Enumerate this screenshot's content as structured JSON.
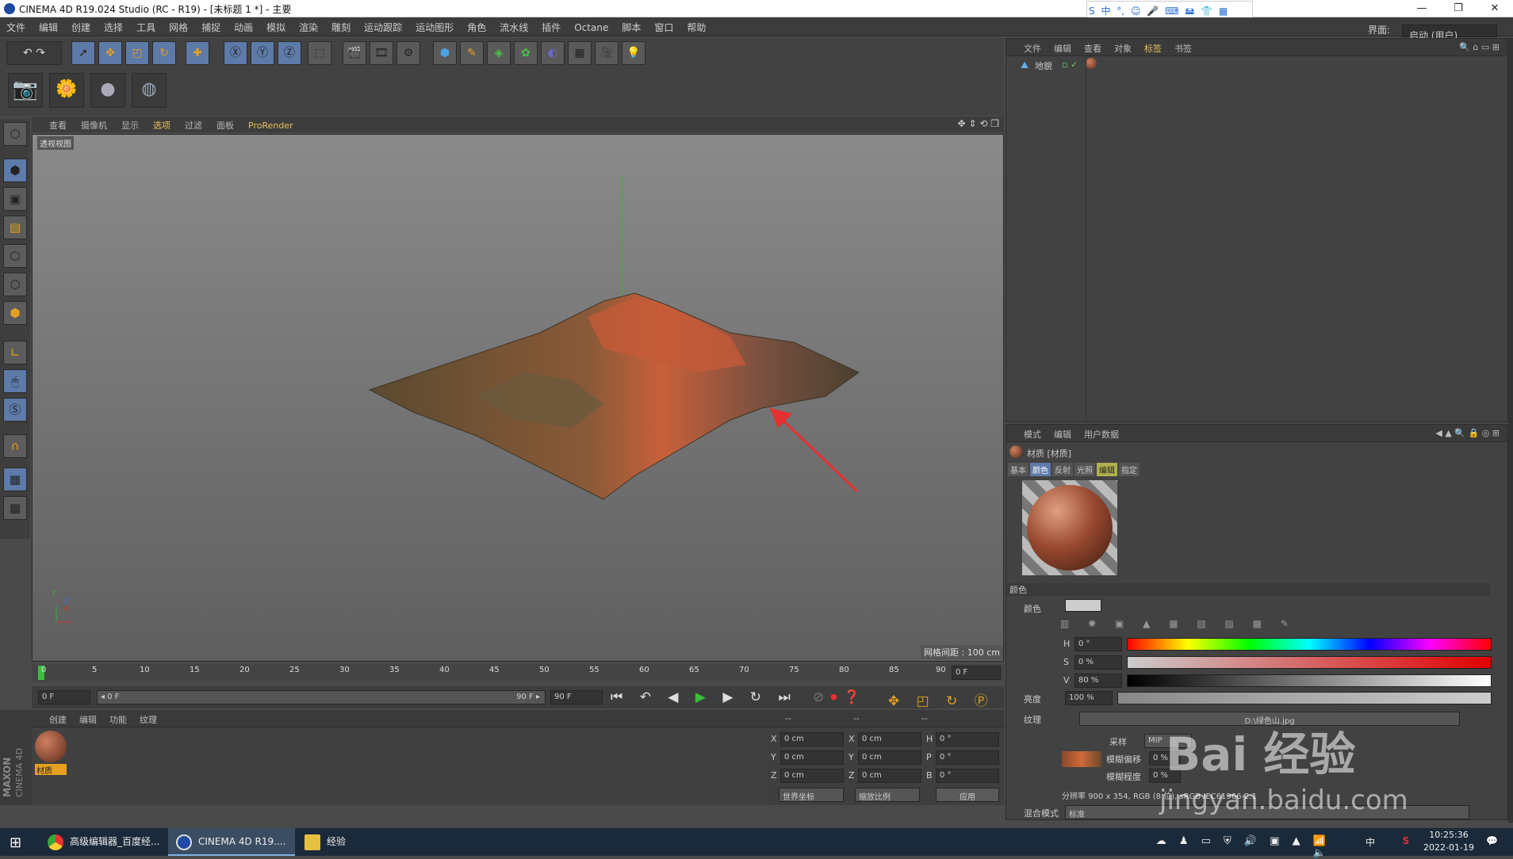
{
  "window": {
    "title": "CINEMA 4D R19.024 Studio (RC - R19) - [未标题 1 *] - 主要",
    "minimize": "—",
    "restore": "❐",
    "close": "✕"
  },
  "ime": {
    "items": [
      "S",
      "中",
      "°,",
      "☺",
      "🎤",
      "⌨",
      "🖴",
      "👕",
      "▦"
    ]
  },
  "menu": [
    "文件",
    "编辑",
    "创建",
    "选择",
    "工具",
    "网格",
    "捕捉",
    "动画",
    "模拟",
    "渲染",
    "雕刻",
    "运动跟踪",
    "运动图形",
    "角色",
    "流水线",
    "插件",
    "Octane",
    "脚本",
    "窗口",
    "帮助"
  ],
  "layout": {
    "label": "界面:",
    "value": "启动 (用户)"
  },
  "viewport": {
    "menu": [
      "查看",
      "摄像机",
      "显示",
      "选项",
      "过滤",
      "面板",
      "ProRender"
    ],
    "title": "透视视图",
    "grid_info": "网格间距 : 100 cm",
    "axes": [
      "Y",
      "Z",
      "X"
    ]
  },
  "timeline": {
    "ticks": [
      "0",
      "5",
      "10",
      "15",
      "20",
      "25",
      "30",
      "35",
      "40",
      "45",
      "50",
      "55",
      "60",
      "65",
      "70",
      "75",
      "80",
      "85",
      "90"
    ],
    "current_frame": "0 F",
    "start_field": "0 F",
    "range_start": "◂ 0 F",
    "range_end": "90 F ▸",
    "end_field": "90 F"
  },
  "material_manager": {
    "menu": [
      "创建",
      "编辑",
      "功能",
      "纹理"
    ],
    "material_name": "材质",
    "brand1": "MAXON",
    "brand2": "CINEMA 4D"
  },
  "coordinates": {
    "headers": [
      "--",
      "--",
      "--"
    ],
    "rows": [
      {
        "a": "X",
        "av": "0 cm",
        "b": "X",
        "bv": "0 cm",
        "c": "H",
        "cv": "0 °"
      },
      {
        "a": "Y",
        "av": "0 cm",
        "b": "Y",
        "bv": "0 cm",
        "c": "P",
        "cv": "0 °"
      },
      {
        "a": "Z",
        "av": "0 cm",
        "b": "Z",
        "bv": "0 cm",
        "c": "B",
        "cv": "0 °"
      }
    ],
    "world": "世界坐标",
    "scale": "缩放比例",
    "apply": "应用"
  },
  "object_manager": {
    "menu": [
      "文件",
      "编辑",
      "查看",
      "对象",
      "标签",
      "书签"
    ],
    "object_name": "地貌"
  },
  "attribute_manager": {
    "menu": [
      "模式",
      "编辑",
      "用户数据"
    ],
    "title": "材质 [材质]",
    "tabs": [
      "基本",
      "颜色",
      "反射",
      "光照",
      "编辑",
      "指定"
    ],
    "section": "颜色",
    "color_label": "颜色",
    "h_label": "H",
    "h_value": "0 °",
    "s_label": "S",
    "s_value": "0 %",
    "v_label": "V",
    "v_value": "80 %",
    "brightness_label": "亮度",
    "brightness_value": "100 %",
    "texture_label": "纹理",
    "texture_file": "D:\\绿色山.jpg",
    "sampling_label": "采样",
    "sampling_value": "MIP",
    "blur_offset_label": "模糊偏移",
    "blur_offset_value": "0 %",
    "blur_level_label": "模糊程度",
    "blur_level_value": "0 %",
    "resolution": "分辨率 900 x 354, RGB (8 位), sRGB IEC61966-2.1",
    "blend_label": "混合模式",
    "blend_value": "标准"
  },
  "taskbar": {
    "tasks": [
      "高级编辑器_百度经...",
      "CINEMA 4D R19....",
      "经验"
    ],
    "lang": "中",
    "time": "10:25:36",
    "date": "2022-01-19"
  },
  "watermark": {
    "text1": "Bai 经验",
    "text2": "jingyan.baidu.com"
  }
}
